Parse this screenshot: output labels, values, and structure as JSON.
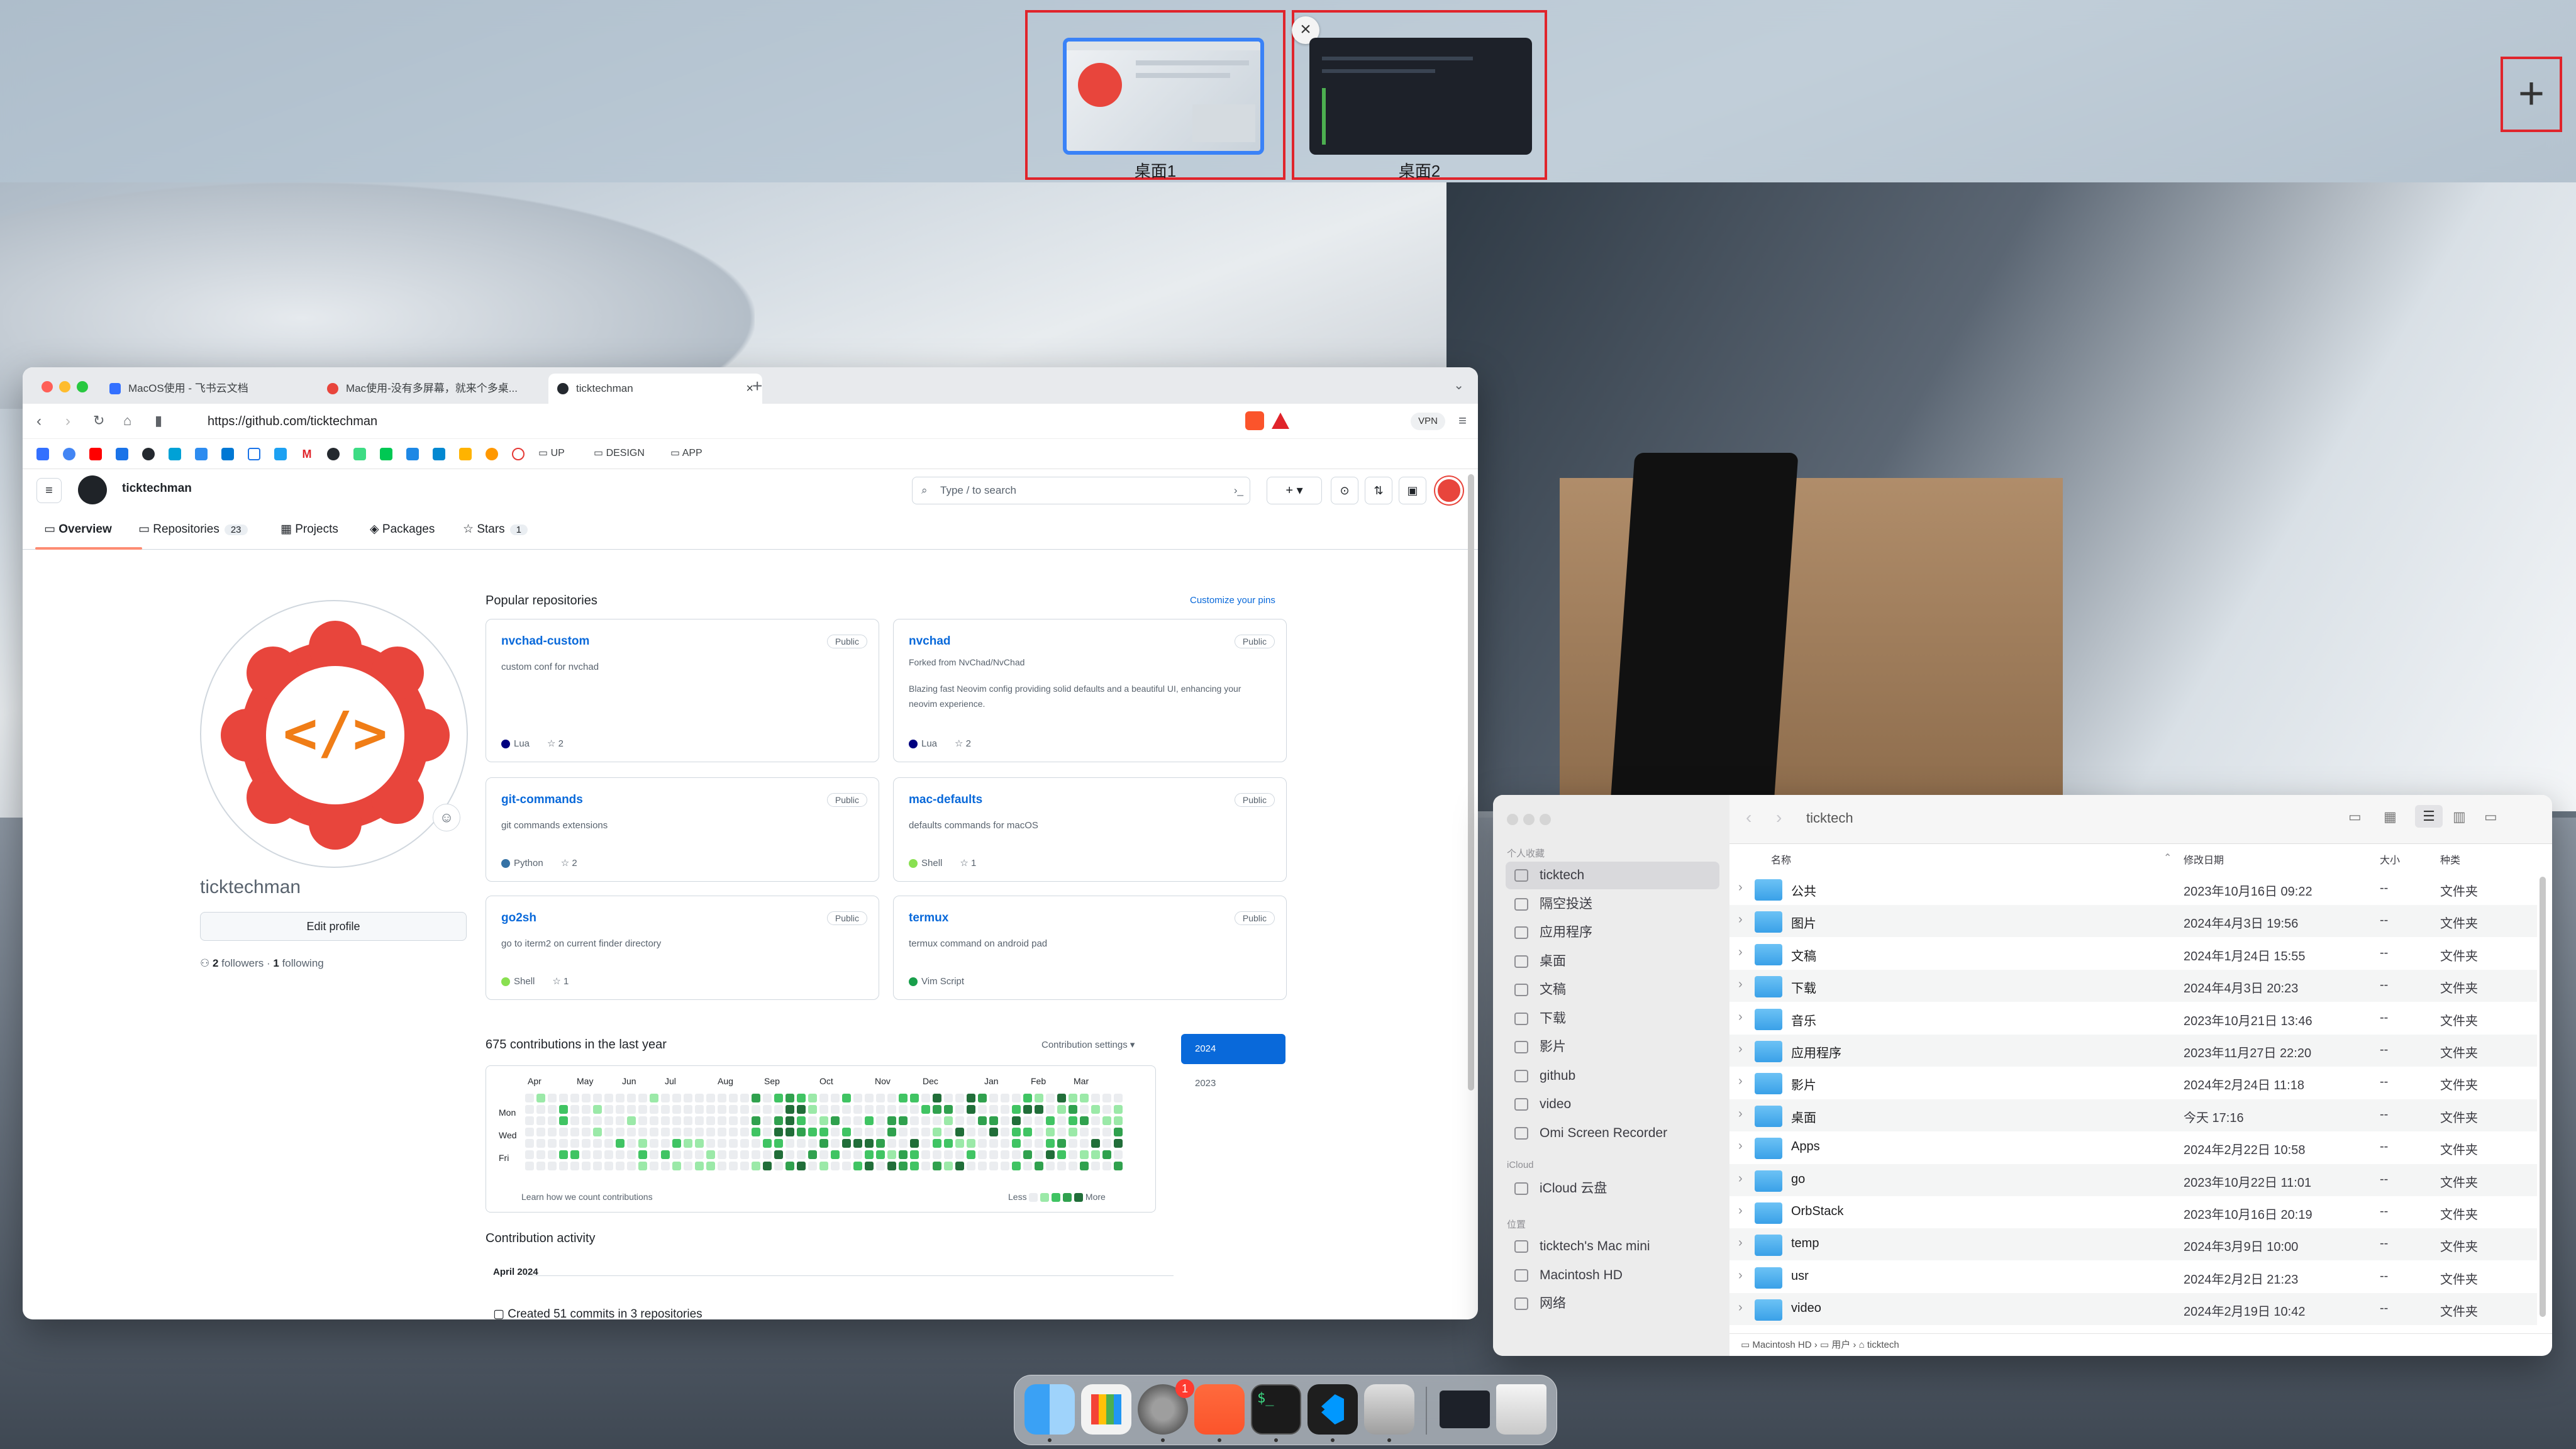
{
  "mission_control": {
    "spaces": [
      {
        "label": "桌面1"
      },
      {
        "label": "桌面2"
      }
    ],
    "add_space": "+",
    "close_space": "×"
  },
  "browser": {
    "tabs": [
      {
        "title": "MacOS使用 - 飞书云文档"
      },
      {
        "title": "Mac使用-没有多屏幕，就来个多桌..."
      },
      {
        "title": "ticktechman"
      }
    ],
    "new_tab": "+",
    "url": "https://github.com/ticktechman",
    "vpn": "VPN",
    "bookmark_folders": [
      "UP",
      "DESIGN",
      "APP"
    ]
  },
  "github": {
    "username_header": "ticktechman",
    "search_placeholder": "Type / to search",
    "tabs": [
      {
        "label": "Overview",
        "count": ""
      },
      {
        "label": "Repositories",
        "count": "23"
      },
      {
        "label": "Projects",
        "count": ""
      },
      {
        "label": "Packages",
        "count": ""
      },
      {
        "label": "Stars",
        "count": "1"
      }
    ],
    "profile_name": "ticktechman",
    "edit_profile": "Edit profile",
    "followers": "2",
    "followers_label": "followers",
    "following": "1",
    "following_label": "following",
    "popular_title": "Popular repositories",
    "customize_pins": "Customize your pins",
    "repos": [
      {
        "name": "nvchad-custom",
        "visibility": "Public",
        "desc": "custom conf for nvchad",
        "lang": "Lua",
        "lang_color": "#000080",
        "stars": "2"
      },
      {
        "name": "nvchad",
        "visibility": "Public",
        "forked": "Forked from NvChad/NvChad",
        "desc": "Blazing fast Neovim config providing solid defaults and a beautiful UI, enhancing your neovim experience.",
        "lang": "Lua",
        "lang_color": "#000080",
        "stars": "2"
      },
      {
        "name": "git-commands",
        "visibility": "Public",
        "desc": "git commands extensions",
        "lang": "Python",
        "lang_color": "#3572A5",
        "stars": "2"
      },
      {
        "name": "mac-defaults",
        "visibility": "Public",
        "desc": "defaults commands for macOS",
        "lang": "Shell",
        "lang_color": "#89e051",
        "stars": "1"
      },
      {
        "name": "go2sh",
        "visibility": "Public",
        "desc": "go to iterm2 on current finder directory",
        "lang": "Shell",
        "lang_color": "#89e051",
        "stars": "1"
      },
      {
        "name": "termux",
        "visibility": "Public",
        "desc": "termux command on android pad",
        "lang": "Vim Script",
        "lang_color": "#199f4b",
        "stars": ""
      }
    ],
    "contrib_title": "675 contributions in the last year",
    "contrib_settings": "Contribution settings",
    "months": [
      "Apr",
      "May",
      "Jun",
      "Jul",
      "Aug",
      "Sep",
      "Oct",
      "Nov",
      "Dec",
      "Jan",
      "Feb",
      "Mar"
    ],
    "days": [
      "Mon",
      "Wed",
      "Fri"
    ],
    "learn": "Learn how we count contributions",
    "less": "Less",
    "more": "More",
    "years": [
      "2024",
      "2023"
    ],
    "activity_title": "Contribution activity",
    "activity_month": "April 2024",
    "activity_item": "Created 51 commits in 3 repositories"
  },
  "finder": {
    "title": "ticktech",
    "sections": {
      "favorites": "个人收藏",
      "icloud": "iCloud",
      "locations": "位置"
    },
    "sidebar_favorites": [
      "ticktech",
      "隔空投送",
      "应用程序",
      "桌面",
      "文稿",
      "下载",
      "影片",
      "github",
      "video",
      "Omi Screen Recorder"
    ],
    "sidebar_icloud": [
      "iCloud 云盘"
    ],
    "sidebar_locations": [
      "ticktech's Mac mini",
      "Macintosh HD",
      "网络"
    ],
    "columns": {
      "name": "名称",
      "date": "修改日期",
      "size": "大小",
      "kind": "种类"
    },
    "rows": [
      {
        "name": "公共",
        "date": "2023年10月16日 09:22",
        "size": "--",
        "kind": "文件夹"
      },
      {
        "name": "图片",
        "date": "2024年4月3日 19:56",
        "size": "--",
        "kind": "文件夹"
      },
      {
        "name": "文稿",
        "date": "2024年1月24日 15:55",
        "size": "--",
        "kind": "文件夹"
      },
      {
        "name": "下载",
        "date": "2024年4月3日 20:23",
        "size": "--",
        "kind": "文件夹"
      },
      {
        "name": "音乐",
        "date": "2023年10月21日 13:46",
        "size": "--",
        "kind": "文件夹"
      },
      {
        "name": "应用程序",
        "date": "2023年11月27日 22:20",
        "size": "--",
        "kind": "文件夹"
      },
      {
        "name": "影片",
        "date": "2024年2月24日 11:18",
        "size": "--",
        "kind": "文件夹"
      },
      {
        "name": "桌面",
        "date": "今天 17:16",
        "size": "--",
        "kind": "文件夹"
      },
      {
        "name": "Apps",
        "date": "2024年2月22日 10:58",
        "size": "--",
        "kind": "文件夹"
      },
      {
        "name": "go",
        "date": "2023年10月22日 11:01",
        "size": "--",
        "kind": "文件夹"
      },
      {
        "name": "OrbStack",
        "date": "2023年10月16日 20:19",
        "size": "--",
        "kind": "文件夹"
      },
      {
        "name": "temp",
        "date": "2024年3月9日 10:00",
        "size": "--",
        "kind": "文件夹"
      },
      {
        "name": "usr",
        "date": "2024年2月2日 21:23",
        "size": "--",
        "kind": "文件夹"
      },
      {
        "name": "video",
        "date": "2024年2月19日 10:42",
        "size": "--",
        "kind": "文件夹"
      }
    ],
    "path": [
      "Macintosh HD",
      "用户",
      "ticktech"
    ]
  },
  "dock": {
    "apps": [
      "finder-icon",
      "launchpad-icon",
      "system-settings-icon",
      "brave-icon",
      "terminal-icon",
      "vscode-icon",
      "preview-icon",
      "screen-icon",
      "trash-icon"
    ],
    "badge": "1"
  }
}
